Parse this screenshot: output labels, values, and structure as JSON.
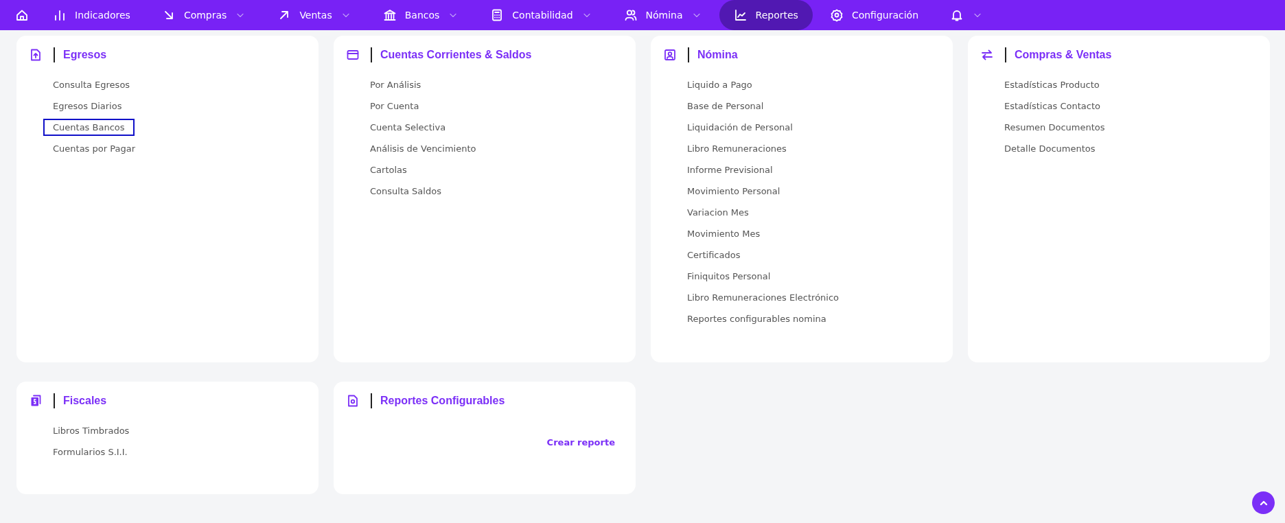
{
  "nav": {
    "items": [
      {
        "dropdown": false,
        "selected": false
      },
      {
        "label": "Indicadores",
        "dropdown": false,
        "selected": false
      },
      {
        "label": "Compras",
        "dropdown": true,
        "selected": false
      },
      {
        "label": "Ventas",
        "dropdown": true,
        "selected": false
      },
      {
        "label": "Bancos",
        "dropdown": true,
        "selected": false
      },
      {
        "label": "Contabilidad",
        "dropdown": true,
        "selected": false
      },
      {
        "label": "Nómina",
        "dropdown": true,
        "selected": false
      },
      {
        "label": "Reportes",
        "dropdown": false,
        "selected": true
      },
      {
        "label": "Configuración",
        "dropdown": false,
        "selected": false
      },
      {
        "dropdown": true,
        "selected": false
      }
    ]
  },
  "cards": [
    {
      "title": "Egresos",
      "items": [
        {
          "label": "Consulta Egresos",
          "focused": false
        },
        {
          "label": "Egresos Diarios",
          "focused": false
        },
        {
          "label": "Cuentas Bancos",
          "focused": true
        },
        {
          "label": "Cuentas por Pagar",
          "focused": false
        }
      ]
    },
    {
      "title": "Cuentas Corrientes & Saldos",
      "items": [
        {
          "label": "Por Análisis",
          "focused": false
        },
        {
          "label": "Por Cuenta",
          "focused": false
        },
        {
          "label": "Cuenta Selectiva",
          "focused": false
        },
        {
          "label": "Análisis de Vencimiento",
          "focused": false
        },
        {
          "label": "Cartolas",
          "focused": false
        },
        {
          "label": "Consulta Saldos",
          "focused": false
        }
      ]
    },
    {
      "title": "Nómina",
      "items": [
        {
          "label": "Liquido a Pago",
          "focused": false
        },
        {
          "label": "Base de Personal",
          "focused": false
        },
        {
          "label": "Liquidación de Personal",
          "focused": false
        },
        {
          "label": "Libro Remuneraciones",
          "focused": false
        },
        {
          "label": "Informe Previsional",
          "focused": false
        },
        {
          "label": "Movimiento Personal",
          "focused": false
        },
        {
          "label": "Variacion Mes",
          "focused": false
        },
        {
          "label": "Movimiento Mes",
          "focused": false
        },
        {
          "label": "Certificados",
          "focused": false
        },
        {
          "label": "Finiquitos Personal",
          "focused": false
        },
        {
          "label": "Libro Remuneraciones Electrónico",
          "focused": false
        },
        {
          "label": "Reportes configurables nomina",
          "focused": false
        }
      ]
    },
    {
      "title": "Compras & Ventas",
      "items": [
        {
          "label": "Estadísticas Producto",
          "focused": false
        },
        {
          "label": "Estadísticas Contacto",
          "focused": false
        },
        {
          "label": "Resumen Documentos",
          "focused": false
        },
        {
          "label": "Detalle Documentos",
          "focused": false
        }
      ]
    },
    {
      "title": "Fiscales",
      "items": [
        {
          "label": "Libros Timbrados",
          "focused": false
        },
        {
          "label": "Formularios S.I.I.",
          "focused": false
        }
      ]
    },
    {
      "title": "Reportes Configurables",
      "action": "Crear reporte"
    }
  ]
}
